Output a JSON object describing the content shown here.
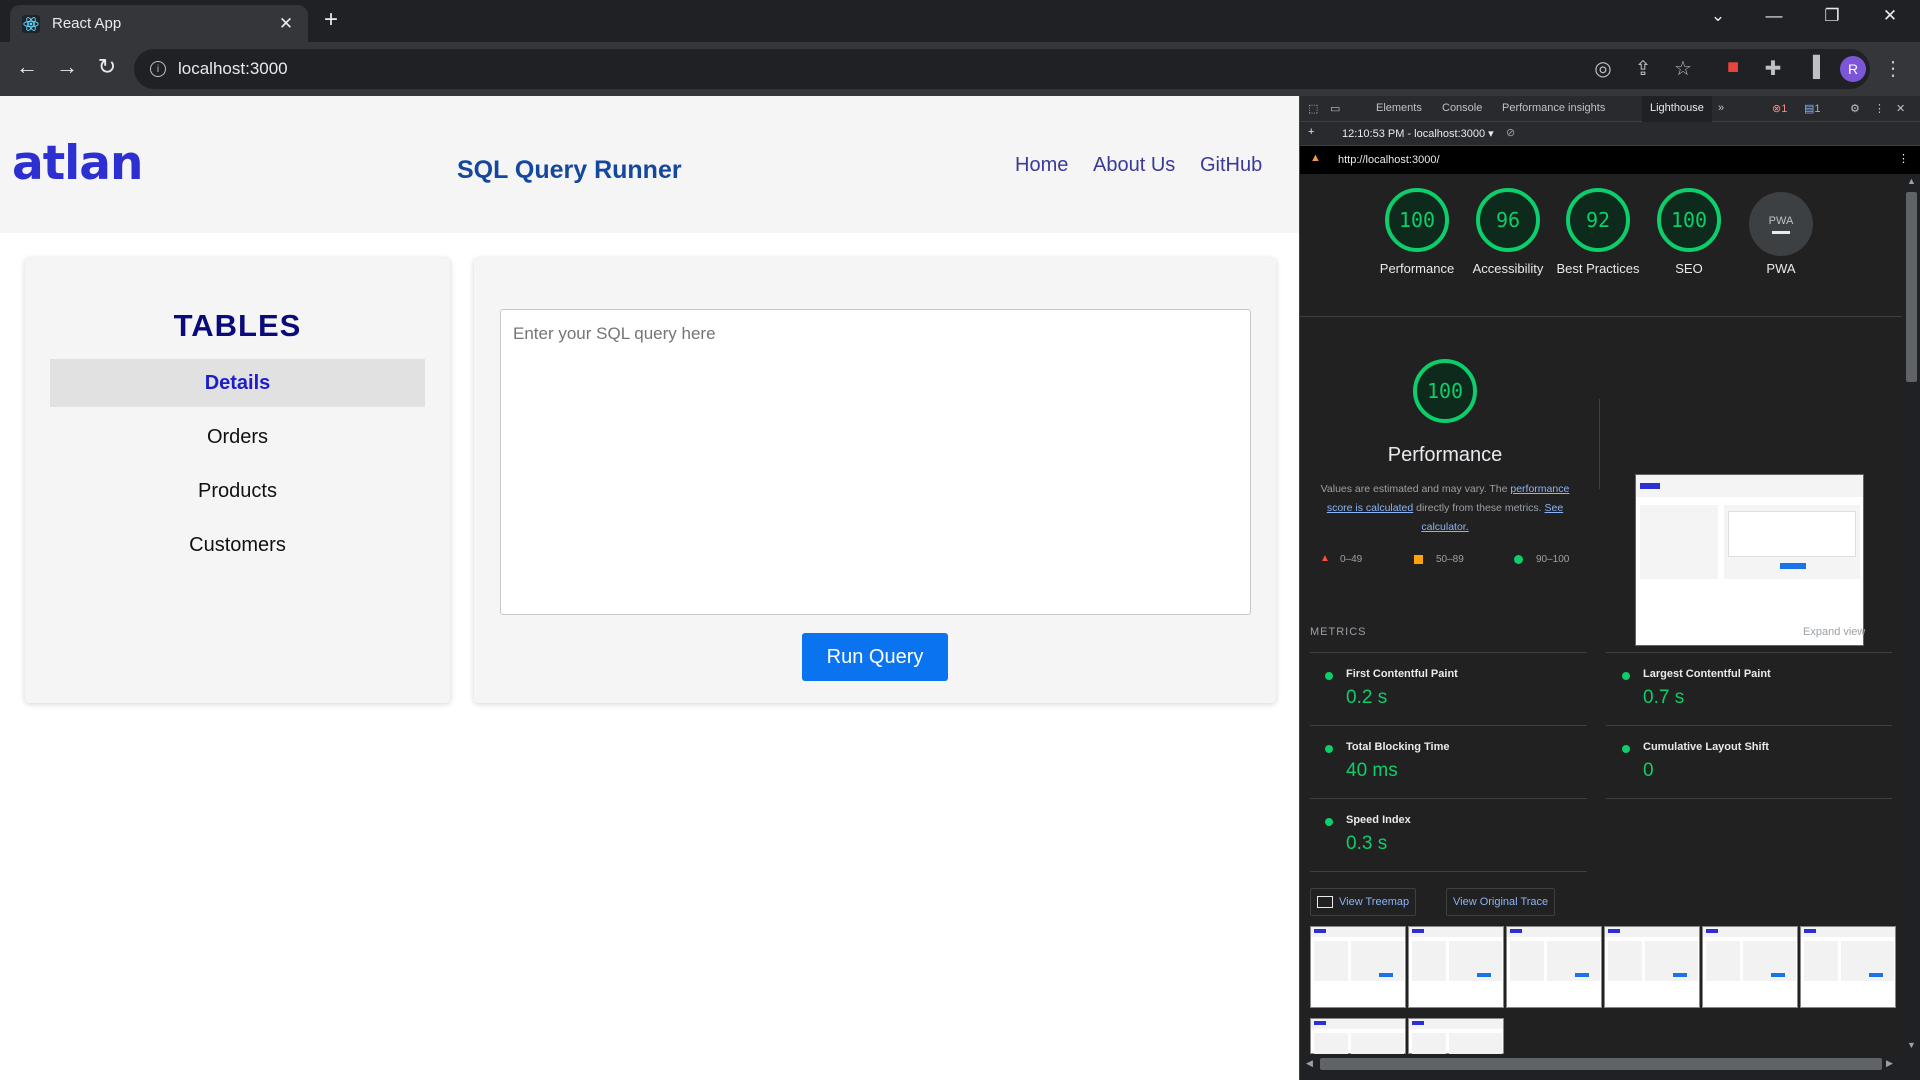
{
  "browser": {
    "tab_title": "React App",
    "url": "localhost:3000"
  },
  "app": {
    "logo": "atlan",
    "title": "SQL Query Runner",
    "nav": [
      "Home",
      "About Us",
      "GitHub"
    ],
    "tables_heading": "TABLES",
    "tables": [
      "Details",
      "Orders",
      "Products",
      "Customers"
    ],
    "active_table": "Details",
    "query_placeholder": "Enter your SQL query here",
    "run_button": "Run Query"
  },
  "devtools": {
    "tabs": [
      "Elements",
      "Console",
      "Performance insights",
      "Lighthouse"
    ],
    "active_tab": "Lighthouse",
    "error_count": "1",
    "message_count": "1",
    "report_selector": "12:10:53 PM - localhost:3000",
    "report_url": "http://localhost:3000/",
    "scores": [
      {
        "label": "Performance",
        "value": "100"
      },
      {
        "label": "Accessibility",
        "value": "96"
      },
      {
        "label": "Best Practices",
        "value": "92"
      },
      {
        "label": "SEO",
        "value": "100"
      }
    ],
    "pwa_label": "PWA",
    "pwa_badge": "PWA",
    "perf_score": "100",
    "perf_title": "Performance",
    "perf_note_1": "Values are estimated and may vary. The ",
    "perf_link_1": "performance score is calculated",
    "perf_note_2": " directly from these metrics. ",
    "perf_link_2": "See calculator.",
    "legend": [
      "0–49",
      "50–89",
      "90–100"
    ],
    "metrics_heading": "METRICS",
    "expand_view": "Expand view",
    "metrics": [
      {
        "name": "First Contentful Paint",
        "value": "0.2 s"
      },
      {
        "name": "Largest Contentful Paint",
        "value": "0.7 s"
      },
      {
        "name": "Total Blocking Time",
        "value": "40 ms"
      },
      {
        "name": "Cumulative Layout Shift",
        "value": "0"
      },
      {
        "name": "Speed Index",
        "value": "0.3 s"
      }
    ],
    "view_treemap": "View Treemap",
    "view_trace": "View Original Trace"
  },
  "colors": {
    "pass": "#0cce6b",
    "average": "#ffa400",
    "fail": "#ff4e42",
    "brand": "#2d2fd1",
    "run_button": "#0a74f0"
  }
}
